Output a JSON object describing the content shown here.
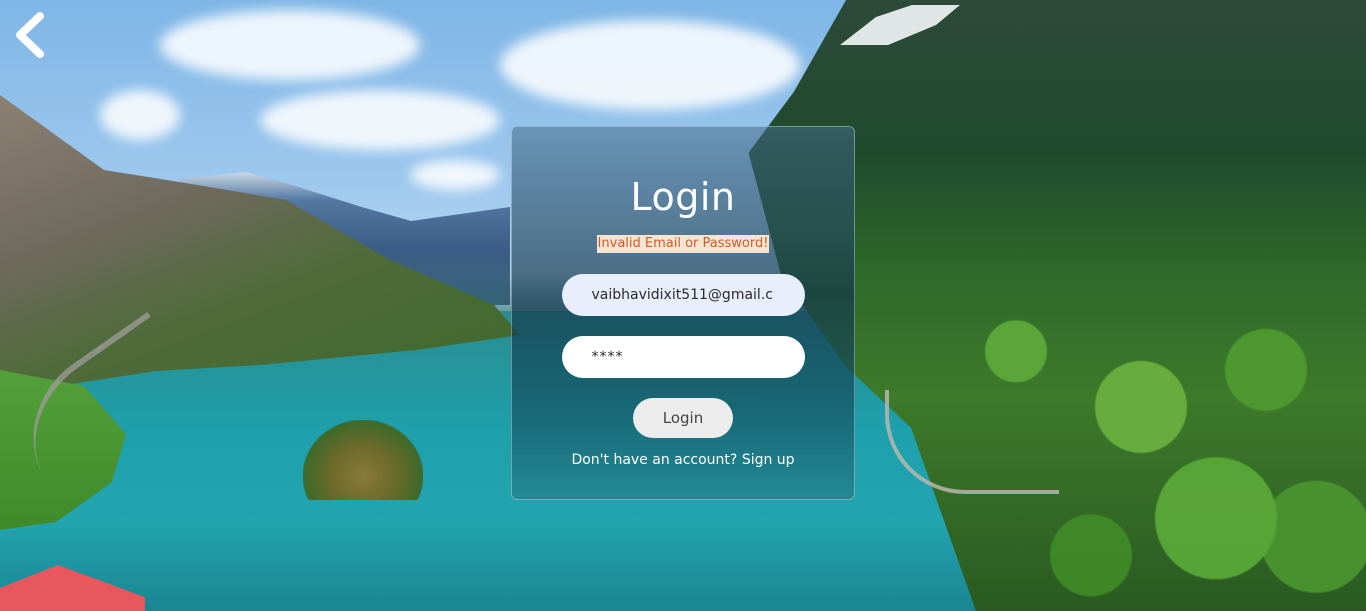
{
  "login": {
    "title": "Login",
    "error_message": "Invalid Email or Password!",
    "email_value": "vaibhavidixit511@gmail.c",
    "password_value": "****",
    "login_button": "Login",
    "signup_prompt": "Don't have an account?",
    "signup_link": "Sign up"
  },
  "icons": {
    "back": "chevron-left-icon"
  },
  "colors": {
    "error_text": "#d45a2e",
    "error_bg": "#f3e6d2",
    "button_bg": "#ececec"
  }
}
